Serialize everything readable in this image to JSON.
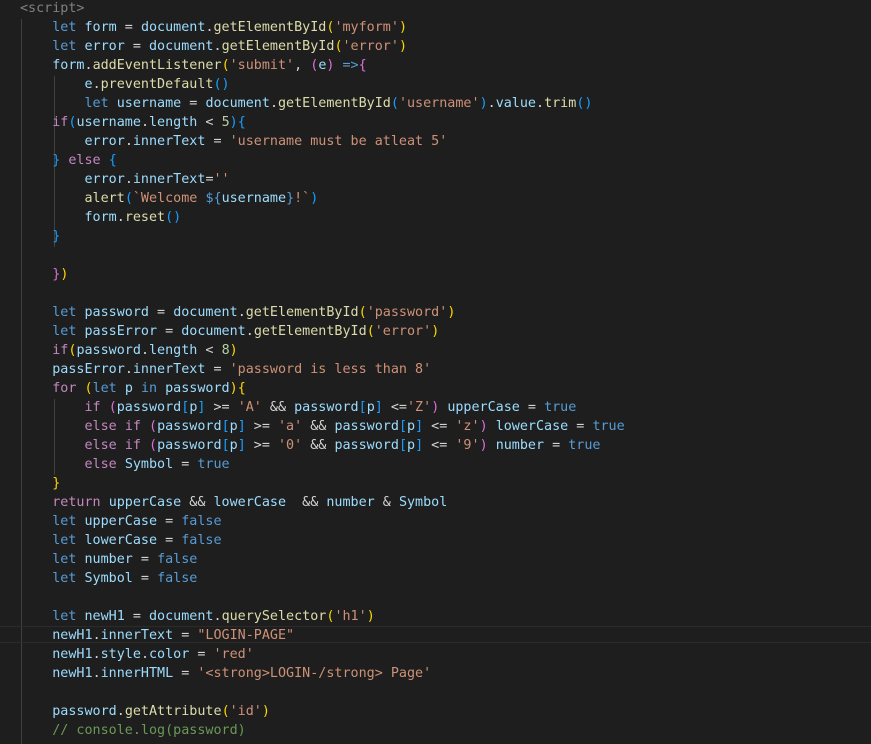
{
  "editor": {
    "language": "javascript",
    "theme_colors": {
      "background": "#1e1e1e",
      "keyword": "#569cd6",
      "control": "#c586c0",
      "variable": "#9cdcfe",
      "function": "#dcdcaa",
      "string": "#ce9178",
      "number": "#b5cea8",
      "comment": "#6a9955",
      "bracket_gold": "#ffd700",
      "bracket_orchid": "#da70d6",
      "bracket_blue": "#179fff"
    },
    "lines": [
      [
        [
          "tag",
          "<script>"
        ]
      ],
      [
        [
          "t",
          "    "
        ],
        [
          "kw",
          "let"
        ],
        [
          "t",
          " "
        ],
        [
          "var",
          "form"
        ],
        [
          "op",
          " = "
        ],
        [
          "var",
          "document"
        ],
        [
          "op",
          "."
        ],
        [
          "fn",
          "getElementById"
        ],
        [
          "b1",
          "("
        ],
        [
          "str",
          "'myform'"
        ],
        [
          "b1",
          ")"
        ]
      ],
      [
        [
          "t",
          "    "
        ],
        [
          "kw",
          "let"
        ],
        [
          "t",
          " "
        ],
        [
          "var",
          "error"
        ],
        [
          "op",
          " = "
        ],
        [
          "var",
          "document"
        ],
        [
          "op",
          "."
        ],
        [
          "fn",
          "getElementById"
        ],
        [
          "b1",
          "("
        ],
        [
          "str",
          "'error'"
        ],
        [
          "b1",
          ")"
        ]
      ],
      [
        [
          "t",
          "    "
        ],
        [
          "var",
          "form"
        ],
        [
          "op",
          "."
        ],
        [
          "fn",
          "addEventListener"
        ],
        [
          "b1",
          "("
        ],
        [
          "str",
          "'submit'"
        ],
        [
          "op",
          ", "
        ],
        [
          "b2",
          "("
        ],
        [
          "var",
          "e"
        ],
        [
          "b2",
          ")"
        ],
        [
          "op",
          " "
        ],
        [
          "kw",
          "=>"
        ],
        [
          "b2",
          "{"
        ]
      ],
      [
        [
          "t",
          "        "
        ],
        [
          "var",
          "e"
        ],
        [
          "op",
          "."
        ],
        [
          "fn",
          "preventDefault"
        ],
        [
          "b3",
          "()"
        ]
      ],
      [
        [
          "t",
          "        "
        ],
        [
          "kw",
          "let"
        ],
        [
          "t",
          " "
        ],
        [
          "var",
          "username"
        ],
        [
          "op",
          " = "
        ],
        [
          "var",
          "document"
        ],
        [
          "op",
          "."
        ],
        [
          "fn",
          "getElementById"
        ],
        [
          "b3",
          "("
        ],
        [
          "str",
          "'username'"
        ],
        [
          "b3",
          ")"
        ],
        [
          "op",
          "."
        ],
        [
          "var",
          "value"
        ],
        [
          "op",
          "."
        ],
        [
          "fn",
          "trim"
        ],
        [
          "b3",
          "()"
        ]
      ],
      [
        [
          "t",
          "    "
        ],
        [
          "ctl",
          "if"
        ],
        [
          "b3",
          "("
        ],
        [
          "var",
          "username"
        ],
        [
          "op",
          "."
        ],
        [
          "var",
          "length"
        ],
        [
          "op",
          " < "
        ],
        [
          "num",
          "5"
        ],
        [
          "b3",
          ")"
        ],
        [
          "b3",
          "{"
        ]
      ],
      [
        [
          "t",
          "        "
        ],
        [
          "var",
          "error"
        ],
        [
          "op",
          "."
        ],
        [
          "var",
          "innerText"
        ],
        [
          "op",
          " = "
        ],
        [
          "str",
          "'username must be atleat 5'"
        ]
      ],
      [
        [
          "t",
          "    "
        ],
        [
          "b3",
          "}"
        ],
        [
          "t",
          " "
        ],
        [
          "ctl",
          "else"
        ],
        [
          "t",
          " "
        ],
        [
          "b3",
          "{"
        ]
      ],
      [
        [
          "t",
          "        "
        ],
        [
          "var",
          "error"
        ],
        [
          "op",
          "."
        ],
        [
          "var",
          "innerText"
        ],
        [
          "op",
          "="
        ],
        [
          "str",
          "''"
        ]
      ],
      [
        [
          "t",
          "        "
        ],
        [
          "fn",
          "alert"
        ],
        [
          "b3",
          "("
        ],
        [
          "str",
          "`Welcome "
        ],
        [
          "kw",
          "${"
        ],
        [
          "var",
          "username"
        ],
        [
          "kw",
          "}"
        ],
        [
          "str",
          "!`"
        ],
        [
          "b3",
          ")"
        ]
      ],
      [
        [
          "t",
          "        "
        ],
        [
          "var",
          "form"
        ],
        [
          "op",
          "."
        ],
        [
          "fn",
          "reset"
        ],
        [
          "b3",
          "()"
        ]
      ],
      [
        [
          "t",
          "    "
        ],
        [
          "b3",
          "}"
        ]
      ],
      [
        [
          "t",
          ""
        ]
      ],
      [
        [
          "t",
          "    "
        ],
        [
          "b2",
          "}"
        ],
        [
          "b1",
          ")"
        ]
      ],
      [
        [
          "t",
          ""
        ]
      ],
      [
        [
          "t",
          "    "
        ],
        [
          "kw",
          "let"
        ],
        [
          "t",
          " "
        ],
        [
          "var",
          "password"
        ],
        [
          "op",
          " = "
        ],
        [
          "var",
          "document"
        ],
        [
          "op",
          "."
        ],
        [
          "fn",
          "getElementById"
        ],
        [
          "b1",
          "("
        ],
        [
          "str",
          "'password'"
        ],
        [
          "b1",
          ")"
        ]
      ],
      [
        [
          "t",
          "    "
        ],
        [
          "kw",
          "let"
        ],
        [
          "t",
          " "
        ],
        [
          "var",
          "passError"
        ],
        [
          "op",
          " = "
        ],
        [
          "var",
          "document"
        ],
        [
          "op",
          "."
        ],
        [
          "fn",
          "getElementById"
        ],
        [
          "b1",
          "("
        ],
        [
          "str",
          "'error'"
        ],
        [
          "b1",
          ")"
        ]
      ],
      [
        [
          "t",
          "    "
        ],
        [
          "ctl",
          "if"
        ],
        [
          "b1",
          "("
        ],
        [
          "var",
          "password"
        ],
        [
          "op",
          "."
        ],
        [
          "var",
          "length"
        ],
        [
          "op",
          " < "
        ],
        [
          "num",
          "8"
        ],
        [
          "b1",
          ")"
        ]
      ],
      [
        [
          "t",
          "    "
        ],
        [
          "var",
          "passError"
        ],
        [
          "op",
          "."
        ],
        [
          "var",
          "innerText"
        ],
        [
          "op",
          " = "
        ],
        [
          "str",
          "'password is less than 8'"
        ]
      ],
      [
        [
          "t",
          "    "
        ],
        [
          "ctl",
          "for"
        ],
        [
          "t",
          " "
        ],
        [
          "b1",
          "("
        ],
        [
          "kw",
          "let"
        ],
        [
          "t",
          " "
        ],
        [
          "var",
          "p"
        ],
        [
          "t",
          " "
        ],
        [
          "kw",
          "in"
        ],
        [
          "t",
          " "
        ],
        [
          "var",
          "password"
        ],
        [
          "b1",
          ")"
        ],
        [
          "b1",
          "{"
        ]
      ],
      [
        [
          "t",
          "        "
        ],
        [
          "ctl",
          "if"
        ],
        [
          "t",
          " "
        ],
        [
          "b2",
          "("
        ],
        [
          "var",
          "password"
        ],
        [
          "b3",
          "["
        ],
        [
          "var",
          "p"
        ],
        [
          "b3",
          "]"
        ],
        [
          "op",
          " >= "
        ],
        [
          "str",
          "'A'"
        ],
        [
          "op",
          " && "
        ],
        [
          "var",
          "password"
        ],
        [
          "b3",
          "["
        ],
        [
          "var",
          "p"
        ],
        [
          "b3",
          "]"
        ],
        [
          "op",
          " <="
        ],
        [
          "str",
          "'Z'"
        ],
        [
          "b2",
          ")"
        ],
        [
          "t",
          " "
        ],
        [
          "var",
          "upperCase"
        ],
        [
          "op",
          " = "
        ],
        [
          "kw",
          "true"
        ]
      ],
      [
        [
          "t",
          "        "
        ],
        [
          "ctl",
          "else"
        ],
        [
          "t",
          " "
        ],
        [
          "ctl",
          "if"
        ],
        [
          "t",
          " "
        ],
        [
          "b2",
          "("
        ],
        [
          "var",
          "password"
        ],
        [
          "b3",
          "["
        ],
        [
          "var",
          "p"
        ],
        [
          "b3",
          "]"
        ],
        [
          "op",
          " >= "
        ],
        [
          "str",
          "'a'"
        ],
        [
          "op",
          " && "
        ],
        [
          "var",
          "password"
        ],
        [
          "b3",
          "["
        ],
        [
          "var",
          "p"
        ],
        [
          "b3",
          "]"
        ],
        [
          "op",
          " <= "
        ],
        [
          "str",
          "'z'"
        ],
        [
          "b2",
          ")"
        ],
        [
          "t",
          " "
        ],
        [
          "var",
          "lowerCase"
        ],
        [
          "op",
          " = "
        ],
        [
          "kw",
          "true"
        ]
      ],
      [
        [
          "t",
          "        "
        ],
        [
          "ctl",
          "else"
        ],
        [
          "t",
          " "
        ],
        [
          "ctl",
          "if"
        ],
        [
          "t",
          " "
        ],
        [
          "b2",
          "("
        ],
        [
          "var",
          "password"
        ],
        [
          "b3",
          "["
        ],
        [
          "var",
          "p"
        ],
        [
          "b3",
          "]"
        ],
        [
          "op",
          " >= "
        ],
        [
          "str",
          "'0'"
        ],
        [
          "op",
          " && "
        ],
        [
          "var",
          "password"
        ],
        [
          "b3",
          "["
        ],
        [
          "var",
          "p"
        ],
        [
          "b3",
          "]"
        ],
        [
          "op",
          " <= "
        ],
        [
          "str",
          "'9'"
        ],
        [
          "b2",
          ")"
        ],
        [
          "t",
          " "
        ],
        [
          "var",
          "number"
        ],
        [
          "op",
          " = "
        ],
        [
          "kw",
          "true"
        ]
      ],
      [
        [
          "t",
          "        "
        ],
        [
          "ctl",
          "else"
        ],
        [
          "t",
          " "
        ],
        [
          "var",
          "Symbol"
        ],
        [
          "op",
          " = "
        ],
        [
          "kw",
          "true"
        ]
      ],
      [
        [
          "t",
          "    "
        ],
        [
          "b1",
          "}"
        ]
      ],
      [
        [
          "t",
          "    "
        ],
        [
          "ctl",
          "return"
        ],
        [
          "t",
          " "
        ],
        [
          "var",
          "upperCase"
        ],
        [
          "op",
          " && "
        ],
        [
          "var",
          "lowerCase"
        ],
        [
          "op",
          "  && "
        ],
        [
          "var",
          "number"
        ],
        [
          "op",
          " & "
        ],
        [
          "var",
          "Symbol"
        ]
      ],
      [
        [
          "t",
          "    "
        ],
        [
          "kw",
          "let"
        ],
        [
          "t",
          " "
        ],
        [
          "var",
          "upperCase"
        ],
        [
          "op",
          " = "
        ],
        [
          "kw",
          "false"
        ]
      ],
      [
        [
          "t",
          "    "
        ],
        [
          "kw",
          "let"
        ],
        [
          "t",
          " "
        ],
        [
          "var",
          "lowerCase"
        ],
        [
          "op",
          " = "
        ],
        [
          "kw",
          "false"
        ]
      ],
      [
        [
          "t",
          "    "
        ],
        [
          "kw",
          "let"
        ],
        [
          "t",
          " "
        ],
        [
          "var",
          "number"
        ],
        [
          "op",
          " = "
        ],
        [
          "kw",
          "false"
        ]
      ],
      [
        [
          "t",
          "    "
        ],
        [
          "kw",
          "let"
        ],
        [
          "t",
          " "
        ],
        [
          "var",
          "Symbol"
        ],
        [
          "op",
          " = "
        ],
        [
          "kw",
          "false"
        ]
      ],
      [
        [
          "t",
          ""
        ]
      ],
      [
        [
          "t",
          "    "
        ],
        [
          "kw",
          "let"
        ],
        [
          "t",
          " "
        ],
        [
          "var",
          "newH1"
        ],
        [
          "op",
          " = "
        ],
        [
          "var",
          "document"
        ],
        [
          "op",
          "."
        ],
        [
          "fn",
          "querySelector"
        ],
        [
          "b1",
          "("
        ],
        [
          "str",
          "'h1'"
        ],
        [
          "b1",
          ")"
        ]
      ],
      [
        [
          "t",
          "    "
        ],
        [
          "var",
          "newH1"
        ],
        [
          "op",
          "."
        ],
        [
          "var",
          "innerText"
        ],
        [
          "op",
          " = "
        ],
        [
          "str",
          "\"LOGIN-PAGE\""
        ]
      ],
      [
        [
          "t",
          "    "
        ],
        [
          "var",
          "newH1"
        ],
        [
          "op",
          "."
        ],
        [
          "var",
          "style"
        ],
        [
          "op",
          "."
        ],
        [
          "var",
          "color"
        ],
        [
          "op",
          " = "
        ],
        [
          "str",
          "'red'"
        ]
      ],
      [
        [
          "t",
          "    "
        ],
        [
          "var",
          "newH1"
        ],
        [
          "op",
          "."
        ],
        [
          "var",
          "innerHTML"
        ],
        [
          "op",
          " = "
        ],
        [
          "str",
          "'<strong>LOGIN-/strong> Page'"
        ]
      ],
      [
        [
          "t",
          ""
        ]
      ],
      [
        [
          "t",
          "    "
        ],
        [
          "var",
          "password"
        ],
        [
          "op",
          "."
        ],
        [
          "fn",
          "getAttribute"
        ],
        [
          "b1",
          "("
        ],
        [
          "str",
          "'id'"
        ],
        [
          "b1",
          ")"
        ]
      ],
      [
        [
          "t",
          "    "
        ],
        [
          "cm",
          "// console.log(password)"
        ]
      ]
    ],
    "current_line": 33
  }
}
